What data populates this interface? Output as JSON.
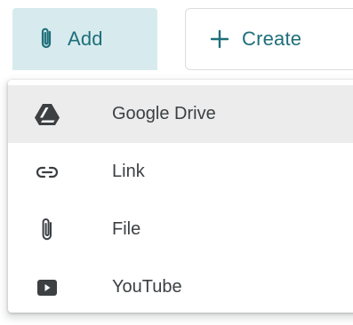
{
  "toolbar": {
    "add_label": "Add",
    "create_label": "Create"
  },
  "menu": {
    "items": [
      {
        "label": "Google Drive",
        "icon": "google-drive-icon",
        "highlighted": true
      },
      {
        "label": "Link",
        "icon": "link-icon"
      },
      {
        "label": "File",
        "icon": "paperclip-icon"
      },
      {
        "label": "YouTube",
        "icon": "youtube-icon"
      }
    ]
  },
  "colors": {
    "accent": "#1e6f7a",
    "add_button_bg": "#d7ebee",
    "icon": "#3c4043",
    "highlight_bg": "#ececec"
  }
}
